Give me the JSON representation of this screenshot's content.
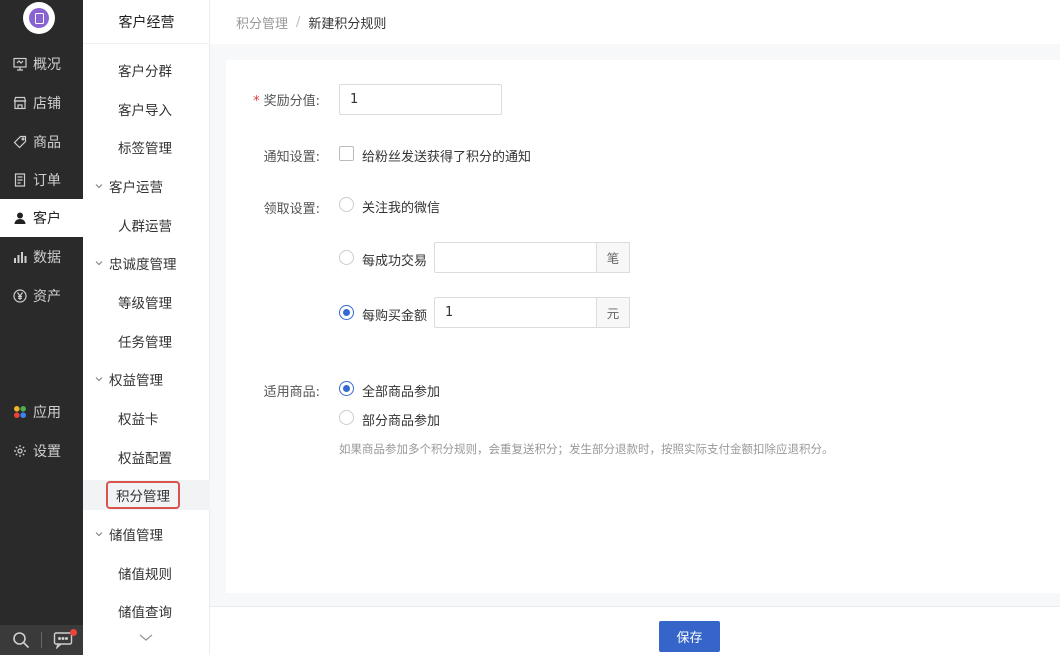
{
  "rail": {
    "items": [
      {
        "label": "概况",
        "icon": "monitor-icon"
      },
      {
        "label": "店铺",
        "icon": "store-icon"
      },
      {
        "label": "商品",
        "icon": "tag-icon"
      },
      {
        "label": "订单",
        "icon": "document-icon"
      },
      {
        "label": "客户",
        "icon": "user-icon"
      },
      {
        "label": "数据",
        "icon": "bar-chart-icon"
      },
      {
        "label": "资产",
        "icon": "yen-circle-icon"
      },
      {
        "label": "应用",
        "icon": "apps-icon"
      },
      {
        "label": "设置",
        "icon": "gear-icon"
      }
    ],
    "active": "客户"
  },
  "sidebar": {
    "title": "客户经营",
    "items": [
      {
        "label": "客户分群",
        "type": "sub"
      },
      {
        "label": "客户导入",
        "type": "sub"
      },
      {
        "label": "标签管理",
        "type": "sub"
      },
      {
        "label": "客户运营",
        "type": "group"
      },
      {
        "label": "人群运营",
        "type": "sub"
      },
      {
        "label": "忠诚度管理",
        "type": "group"
      },
      {
        "label": "等级管理",
        "type": "sub"
      },
      {
        "label": "任务管理",
        "type": "sub"
      },
      {
        "label": "权益管理",
        "type": "group"
      },
      {
        "label": "权益卡",
        "type": "sub"
      },
      {
        "label": "权益配置",
        "type": "sub"
      },
      {
        "label": "积分管理",
        "type": "sub"
      },
      {
        "label": "储值管理",
        "type": "group"
      },
      {
        "label": "储值规则",
        "type": "sub"
      },
      {
        "label": "储值查询",
        "type": "sub"
      }
    ],
    "selected": "积分管理"
  },
  "breadcrumb": {
    "parent": "积分管理",
    "separator": "/",
    "current": "新建积分规则"
  },
  "form": {
    "points": {
      "required_mark": "*",
      "label": "奖励分值:",
      "value": "1"
    },
    "notify": {
      "label": "通知设置:",
      "option": "给粉丝发送获得了积分的通知",
      "checked": false
    },
    "receive": {
      "label": "领取设置:",
      "follow": "关注我的微信",
      "per_trade": {
        "label": "每成功交易",
        "value": "",
        "unit": "笔"
      },
      "per_amount": {
        "label": "每购买金额",
        "value": "1",
        "unit": "元"
      },
      "selected": "per_amount"
    },
    "goods": {
      "label": "适用商品:",
      "all": "全部商品参加",
      "partial": "部分商品参加",
      "selected": "all",
      "hint": "如果商品参加多个积分规则，会重复送积分；发生部分退款时，按照实际支付金额扣除应退积分。"
    }
  },
  "footer": {
    "save_label": "保存"
  },
  "colors": {
    "primary": "#3565c9",
    "rail": "#2a2a2a",
    "highlight": "#d9534f"
  }
}
